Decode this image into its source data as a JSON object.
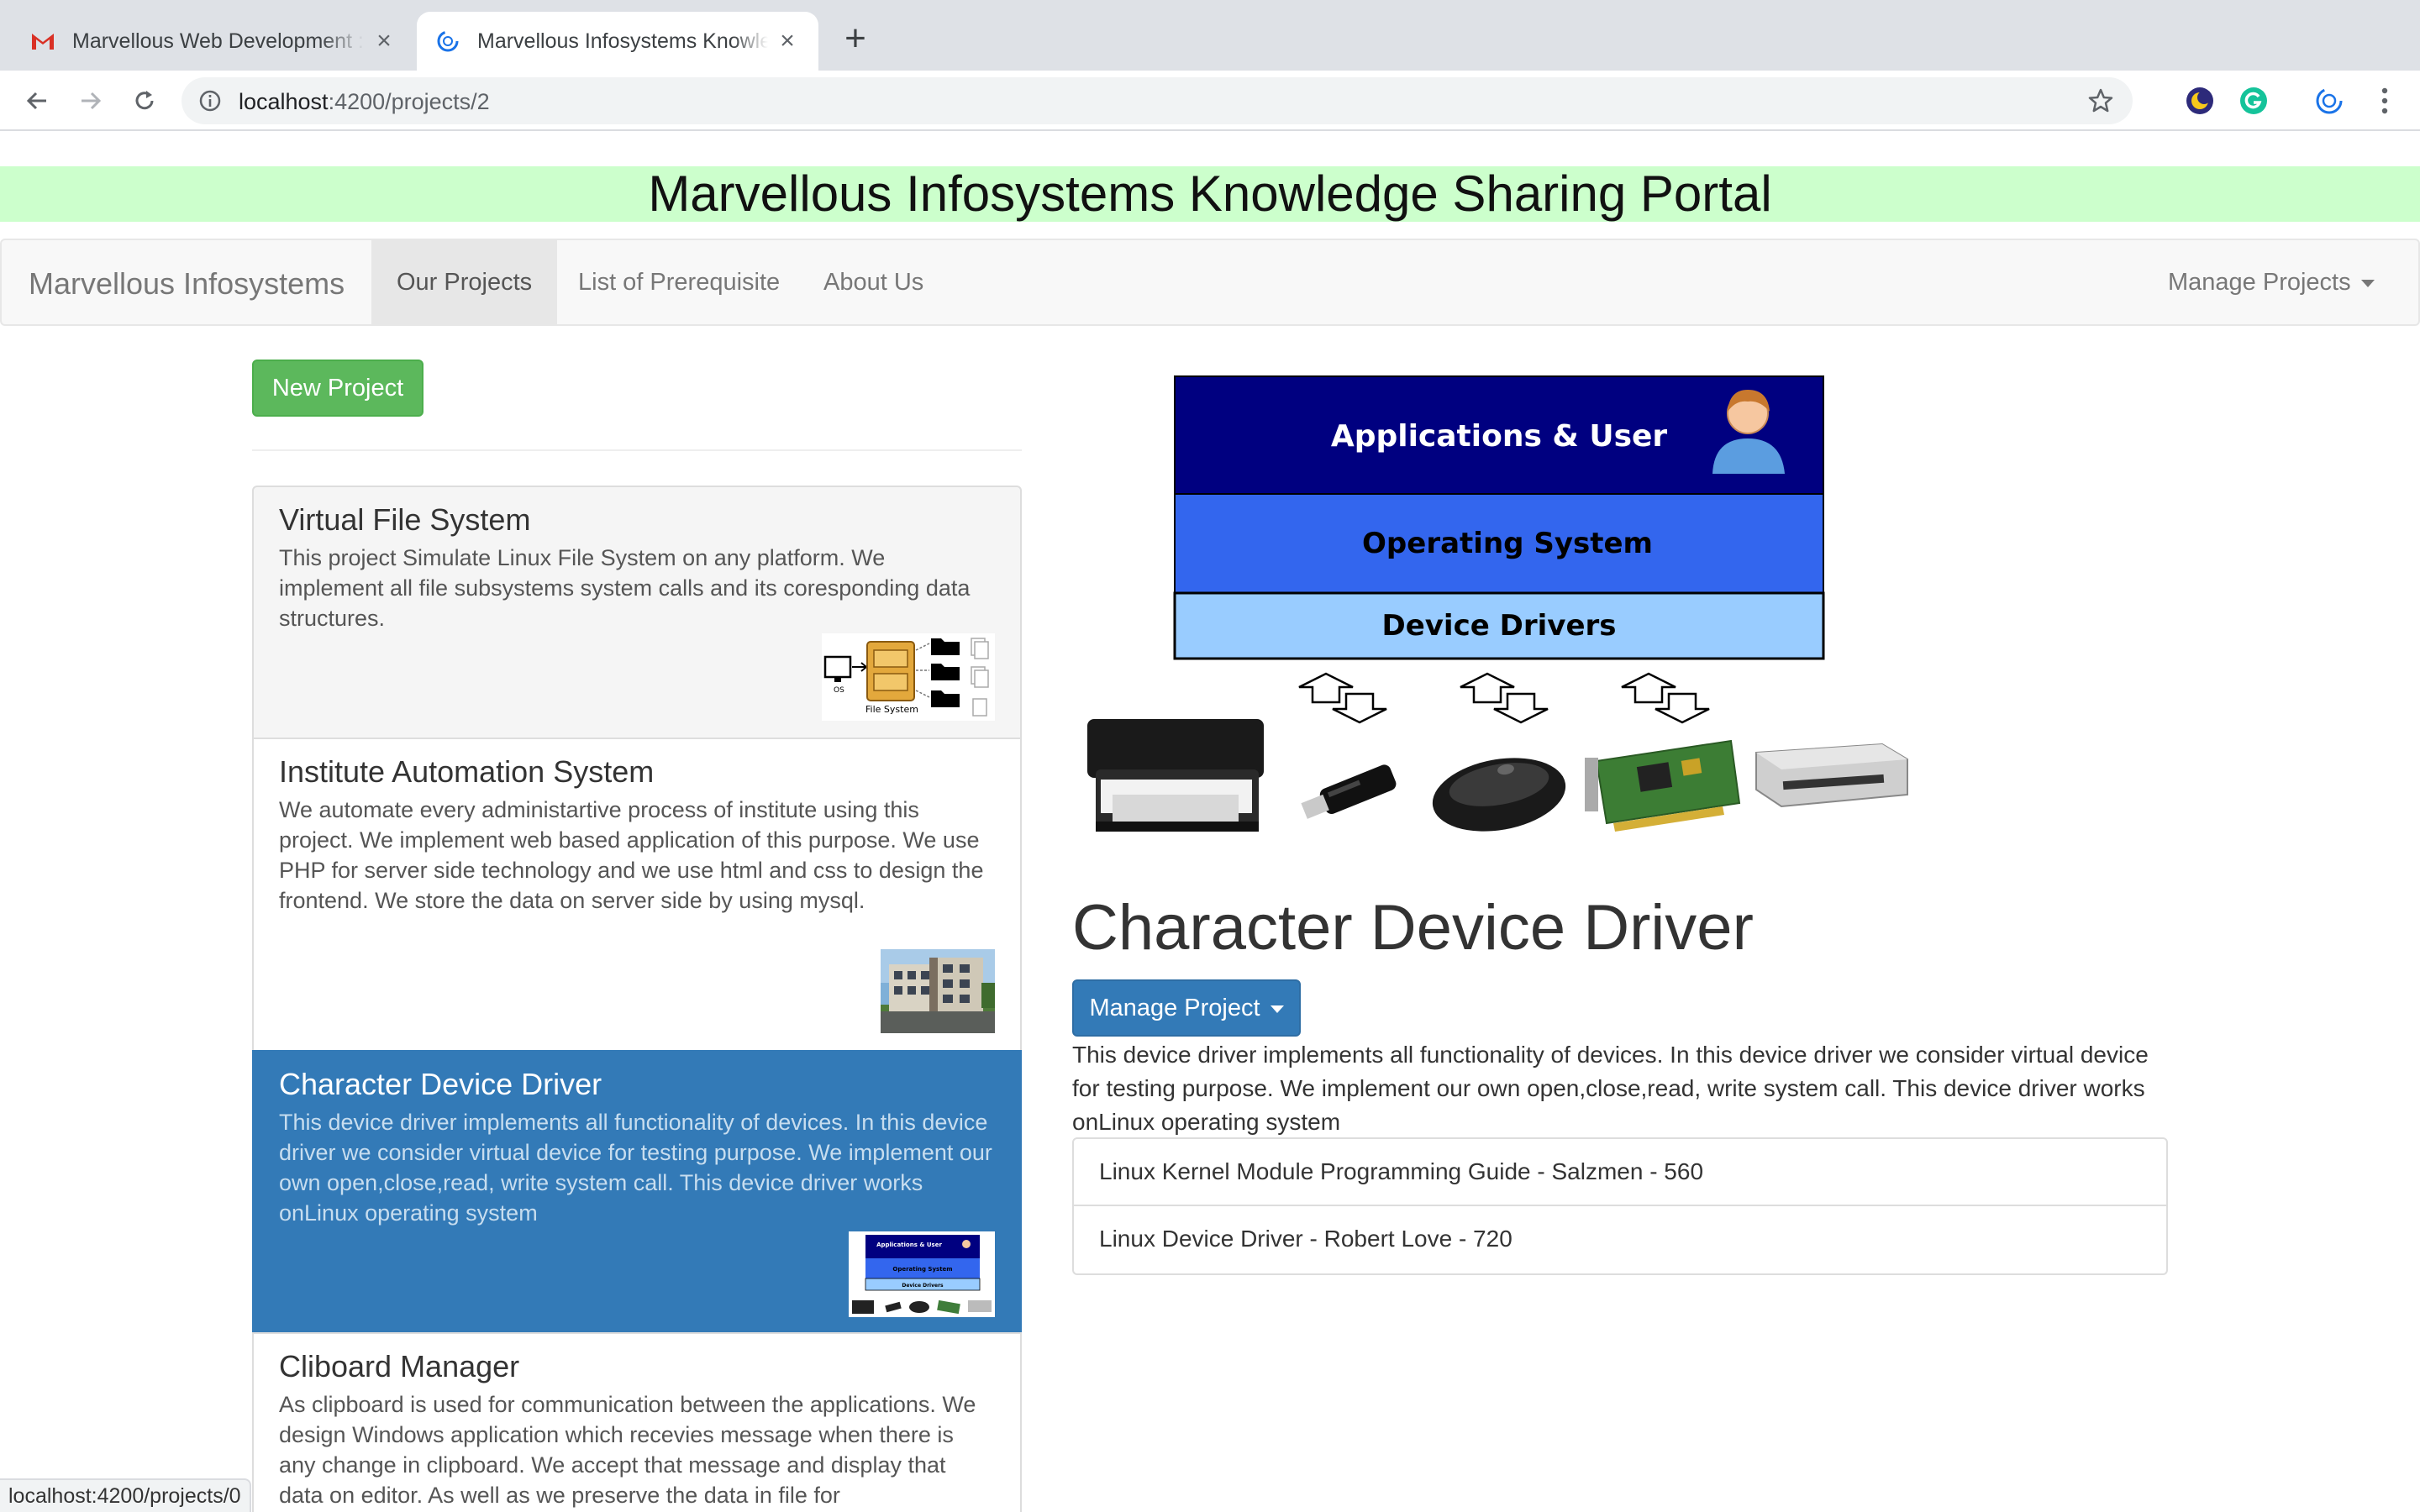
{
  "browser": {
    "tabs": [
      {
        "title": "Marvellous Web Development : ",
        "close": "×"
      },
      {
        "title": "Marvellous Infosystems Knowledge Sharing Portal",
        "close": "×"
      }
    ],
    "new_tab": "+",
    "url_host": "localhost",
    "url_path": ":4200/projects/2"
  },
  "page": {
    "banner": "Marvellous Infosystems Knowledge Sharing Portal",
    "navbar": {
      "brand": "Marvellous Infosystems",
      "links": [
        "Our Projects",
        "List of Prerequisite",
        "About Us"
      ],
      "right_dropdown": "Manage Projects"
    },
    "new_project_button": "New Project",
    "projects": [
      {
        "title": "Virtual File System",
        "description": "This project Simulate Linux File System on any platform. We implement all file subsystems system calls and its coresponding data structures."
      },
      {
        "title": "Institute Automation System",
        "description": "We automate every administartive process of institute using this project. We implement web based application of this purpose. We use PHP for server side technology and we use html and css to design the frontend. We store the data on server side by using mysql."
      },
      {
        "title": "Character Device Driver",
        "description": "This device driver implements all functionality of devices. In this device driver we consider virtual device for testing purpose. We implement our own open,close,read, write system call. This device driver works onLinux operating system"
      },
      {
        "title": "Cliboard Manager",
        "description": "As clipboard is used for communication between the applications. We design Windows application which recevies message when there is any change in clipboard. We accept that message and display that data on editor. As well as we preserve the data in file for"
      }
    ],
    "detail": {
      "diagram": {
        "layer1": "Applications & User",
        "layer2": "Operating System",
        "layer3": "Device Drivers",
        "thumb_layer1": "Applications & User",
        "thumb_layer2": "Operating System",
        "thumb_layer3": "Device Drivers"
      },
      "vfs_thumb": {
        "os": "OS",
        "fs": "File System"
      },
      "title": "Character Device Driver",
      "manage_button": "Manage Project",
      "description": "This device driver implements all functionality of devices. In this device driver we consider virtual device for testing purpose. We implement our own open,close,read, write system call. This device driver works onLinux operating system",
      "books": [
        "Linux Kernel Module Programming Guide - Salzmen - 560",
        "Linux Device Driver - Robert Love - 720"
      ]
    },
    "status_url": "localhost:4200/projects/0"
  },
  "colors": {
    "banner_bg": "#ccffcc",
    "success": "#5cb85c",
    "primary": "#337ab7",
    "diagram_dark": "#000080",
    "diagram_mid": "#3366ee",
    "diagram_light": "#99ccff"
  }
}
